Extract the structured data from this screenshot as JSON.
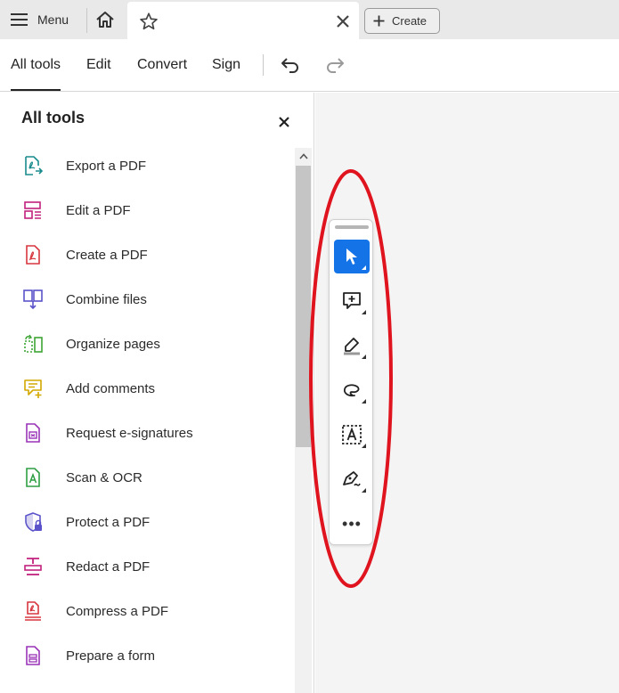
{
  "titlebar": {
    "menu_label": "Menu",
    "create_label": "Create"
  },
  "toolbar": {
    "tabs": [
      {
        "label": "All tools",
        "active": true
      },
      {
        "label": "Edit",
        "active": false
      },
      {
        "label": "Convert",
        "active": false
      },
      {
        "label": "Sign",
        "active": false
      }
    ]
  },
  "panel": {
    "title": "All tools",
    "items": [
      {
        "label": "Export a PDF",
        "icon": "export-pdf-icon",
        "color": "#1a8b8d"
      },
      {
        "label": "Edit a PDF",
        "icon": "edit-pdf-icon",
        "color": "#c2217d"
      },
      {
        "label": "Create a PDF",
        "icon": "create-pdf-icon",
        "color": "#d7373f"
      },
      {
        "label": "Combine files",
        "icon": "combine-files-icon",
        "color": "#5a53c9"
      },
      {
        "label": "Organize pages",
        "icon": "organize-pages-icon",
        "color": "#3ea535"
      },
      {
        "label": "Add comments",
        "icon": "add-comments-icon",
        "color": "#d4a800"
      },
      {
        "label": "Request e-signatures",
        "icon": "request-esignatures-icon",
        "color": "#9a33b8"
      },
      {
        "label": "Scan & OCR",
        "icon": "scan-ocr-icon",
        "color": "#2f9e44"
      },
      {
        "label": "Protect a PDF",
        "icon": "protect-pdf-icon",
        "color": "#5a53c9"
      },
      {
        "label": "Redact a PDF",
        "icon": "redact-pdf-icon",
        "color": "#c2217d"
      },
      {
        "label": "Compress a PDF",
        "icon": "compress-pdf-icon",
        "color": "#d7373f"
      },
      {
        "label": "Prepare a form",
        "icon": "prepare-form-icon",
        "color": "#9a33b8"
      }
    ]
  },
  "quick_tools": [
    {
      "name": "select-tool",
      "selected": true
    },
    {
      "name": "add-comment-tool",
      "selected": false
    },
    {
      "name": "highlight-tool",
      "selected": false
    },
    {
      "name": "draw-tool",
      "selected": false
    },
    {
      "name": "text-recognition-tool",
      "selected": false
    },
    {
      "name": "fill-sign-tool",
      "selected": false
    }
  ],
  "colors": {
    "accent": "#1473e6",
    "annotation": "#e0141e"
  }
}
